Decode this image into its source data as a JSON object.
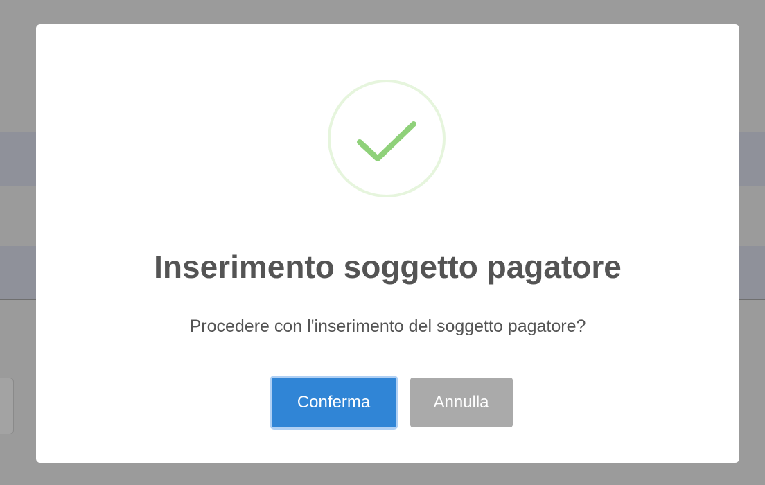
{
  "dialog": {
    "icon": "success-checkmark-icon",
    "title": "Inserimento soggetto pagatore",
    "message": "Procedere con l'inserimento del soggetto pagatore?",
    "confirm_label": "Conferma",
    "cancel_label": "Annulla"
  },
  "colors": {
    "overlay": "#9b9b9b",
    "success": "#a5dc86",
    "confirm": "#3085d6",
    "cancel": "#aaaaaa",
    "text": "#545454"
  }
}
